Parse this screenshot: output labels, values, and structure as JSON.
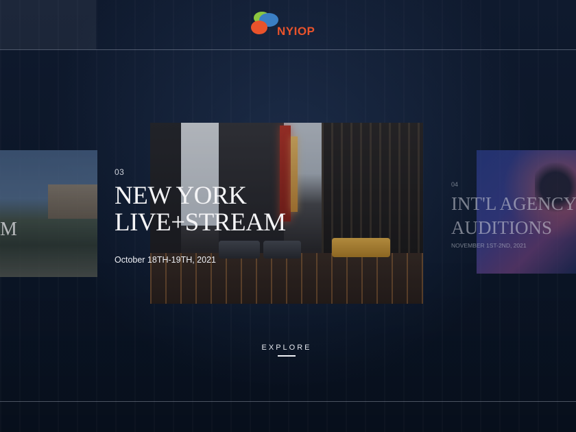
{
  "brand": {
    "logo_text": "NYIOP",
    "logo_colors": [
      "#e9532b",
      "#3b7fc4",
      "#8cc63f"
    ]
  },
  "slides": {
    "previous": {
      "partial_title": "M"
    },
    "current": {
      "number": "03",
      "title_line1": "NEW YORK",
      "title_line2": "LIVE+STREAM",
      "date": "October 18TH-19TH, 2021"
    },
    "next": {
      "number": "04",
      "title_line1": "INT'L AGENCY",
      "title_line2": "AUDITIONS",
      "date": "NOVEMBER 1ST-2ND, 2021"
    }
  },
  "cta": {
    "explore_label": "EXPLORE"
  }
}
